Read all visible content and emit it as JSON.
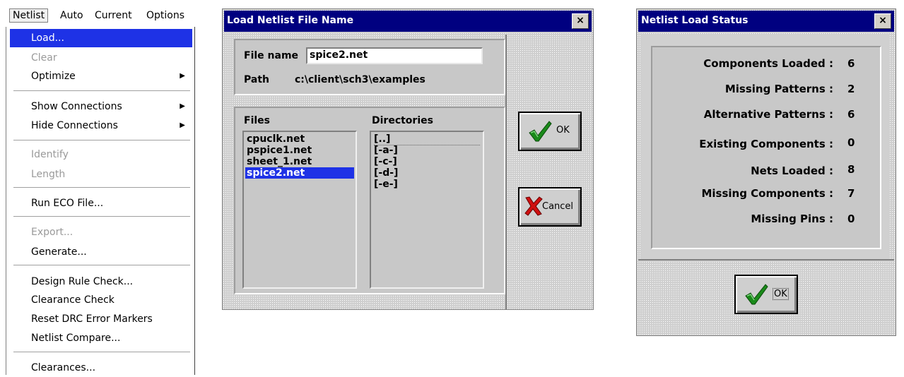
{
  "menubar": {
    "items": [
      "Netlist",
      "Auto",
      "Current",
      "Options"
    ]
  },
  "menu": {
    "items": [
      {
        "label": "Load...",
        "state": "selected"
      },
      {
        "label": "Clear",
        "state": "disabled"
      },
      {
        "label": "Optimize",
        "state": "enabled",
        "submenu": true
      },
      {
        "label": "Show Connections",
        "state": "enabled",
        "submenu": true
      },
      {
        "label": "Hide Connections",
        "state": "enabled",
        "submenu": true
      },
      {
        "label": "Identify",
        "state": "disabled"
      },
      {
        "label": "Length",
        "state": "disabled"
      },
      {
        "label": "Run ECO File...",
        "state": "enabled"
      },
      {
        "label": "Export...",
        "state": "disabled"
      },
      {
        "label": "Generate...",
        "state": "enabled"
      },
      {
        "label": "Design Rule Check...",
        "state": "enabled"
      },
      {
        "label": "Clearance Check",
        "state": "enabled"
      },
      {
        "label": "Reset DRC Error Markers",
        "state": "enabled"
      },
      {
        "label": "Netlist Compare...",
        "state": "enabled"
      },
      {
        "label": "Clearances...",
        "state": "enabled"
      }
    ],
    "submenu_arrow": "▶"
  },
  "load_dialog": {
    "title": "Load Netlist File Name",
    "close": "×",
    "file_name_label": "File name",
    "file_name_value": "spice2.net",
    "path_label": "Path",
    "path_value": "c:\\client\\sch3\\examples",
    "files_label": "Files",
    "files": [
      "cpuclk.net",
      "pspice1.net",
      "sheet_1.net",
      "spice2.net"
    ],
    "selected_file": "spice2.net",
    "directories_label": "Directories",
    "directories": [
      "[..]",
      "[-a-]",
      "[-c-]",
      "[-d-]",
      "[-e-]"
    ],
    "ok_label": "OK",
    "cancel_label": "Cancel",
    "check_icon": "check-icon",
    "x_icon": "red-x-icon"
  },
  "status_dialog": {
    "title": "Netlist Load Status",
    "close": "×",
    "lines": [
      {
        "label": "Components Loaded :",
        "value": "6"
      },
      {
        "label": "Missing Patterns :",
        "value": "2"
      },
      {
        "label": "Alternative Patterns :",
        "value": "6"
      },
      {
        "label": "Existing Components :",
        "value": "0"
      },
      {
        "label": "Nets Loaded :",
        "value": "8"
      },
      {
        "label": "Missing Components :",
        "value": "7"
      },
      {
        "label": "Missing Pins :",
        "value": "0"
      }
    ],
    "ok_label": "OK"
  },
  "colors": {
    "title_bar": "#000080",
    "selection": "#1e32e6",
    "check_green": "#1a8a1a",
    "x_red": "#d01010"
  }
}
